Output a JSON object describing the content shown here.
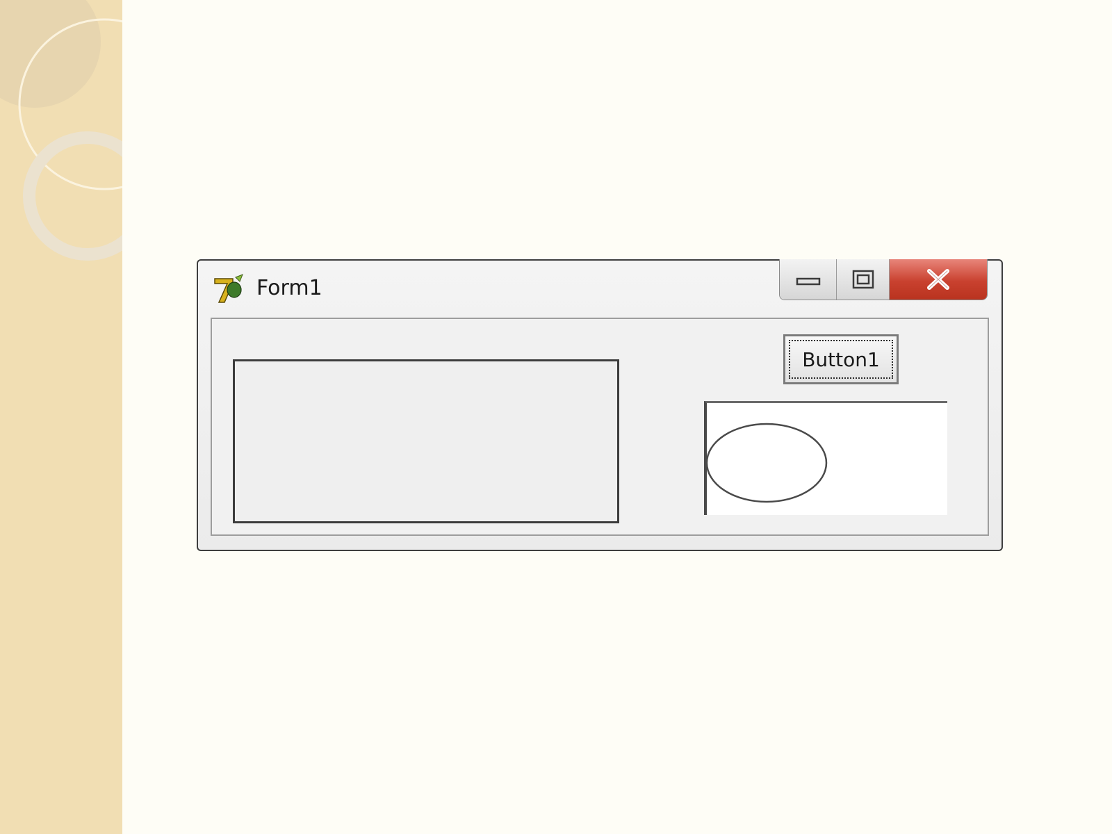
{
  "window": {
    "title": "Form1",
    "app_icon": "delphi-helmet-icon",
    "caption_buttons": {
      "minimize_icon": "minimize-icon",
      "maximize_icon": "maximize-icon",
      "close_icon": "close-icon"
    }
  },
  "form": {
    "button1_label": "Button1"
  },
  "colors": {
    "side_band": "#f1deb3",
    "slide_background": "#fefdf6",
    "close_button": "#c9412f"
  }
}
